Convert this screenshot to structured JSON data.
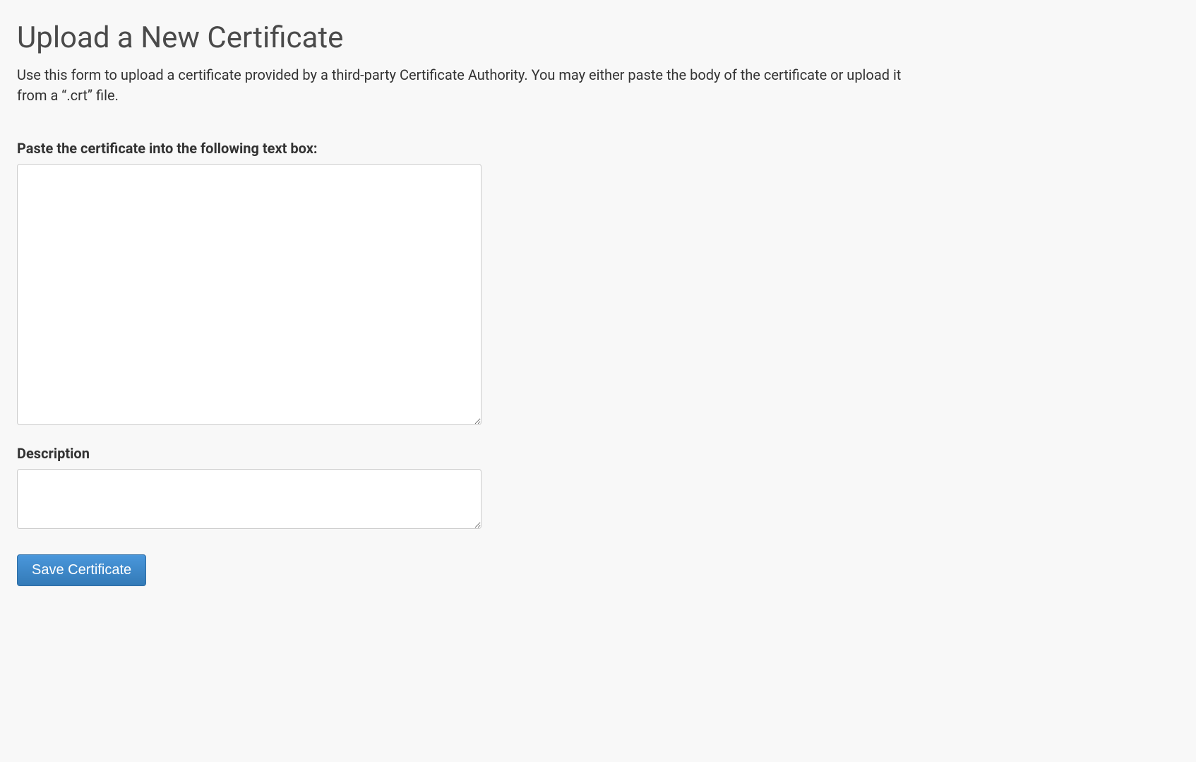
{
  "page": {
    "title": "Upload a New Certificate",
    "description": "Use this form to upload a certificate provided by a third-party Certificate Authority. You may either paste the body of the certificate or upload it from a “.crt” file."
  },
  "form": {
    "certificate": {
      "label": "Paste the certificate into the following text box:",
      "value": ""
    },
    "description": {
      "label": "Description",
      "value": ""
    },
    "submit": {
      "label": "Save Certificate"
    }
  }
}
